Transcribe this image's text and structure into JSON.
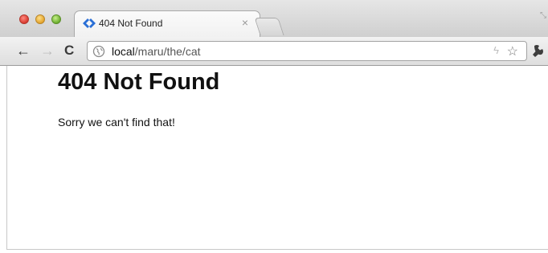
{
  "browser": {
    "tab": {
      "title": "404 Not Found",
      "close_glyph": "×",
      "favicon": "code-brackets-icon",
      "favicon_color": "#2a6fd6"
    },
    "toolbar": {
      "back_glyph": "←",
      "forward_glyph": "→",
      "reload_glyph": "C"
    },
    "address_bar": {
      "host": "local",
      "path": "/maru/the/cat"
    }
  },
  "page": {
    "heading": "404 Not Found",
    "message": "Sorry we can't find that!"
  },
  "colors": {
    "traffic_close": "#d93a2f",
    "traffic_minimize": "#e3a32b",
    "traffic_maximize": "#6cae2e"
  }
}
